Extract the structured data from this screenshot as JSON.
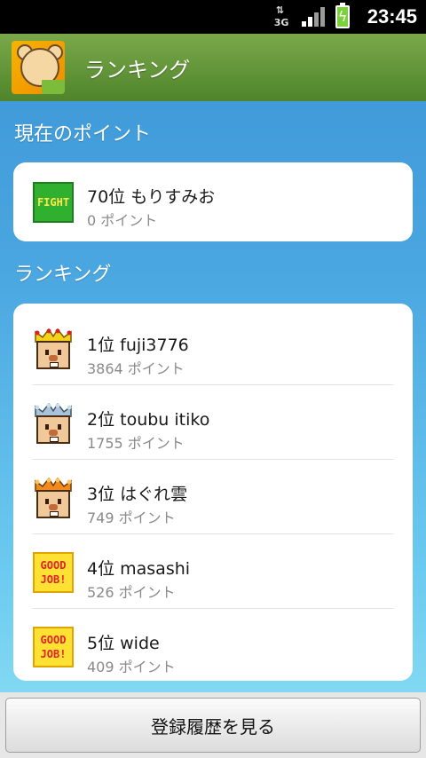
{
  "status_bar": {
    "network": "3G",
    "time": "23:45"
  },
  "header": {
    "title": "ランキング"
  },
  "current_points": {
    "section_title": "現在のポイント",
    "entry": {
      "name": "70位 もりすみお",
      "points": "0 ポイント",
      "badge": "FIGHT"
    }
  },
  "ranking": {
    "section_title": "ランキング",
    "entries": [
      {
        "name": "1位 fuji3776",
        "points": "3864 ポイント",
        "badge": "gold-crown-icon"
      },
      {
        "name": "2位 toubu itiko",
        "points": "1755 ポイント",
        "badge": "silver-crown-icon"
      },
      {
        "name": "3位 はぐれ雲",
        "points": "749 ポイント",
        "badge": "bronze-crown-icon"
      },
      {
        "name": "4位 masashi",
        "points": "526 ポイント",
        "badge_line1": "GOOD",
        "badge_line2": "JOB!"
      },
      {
        "name": "5位 wide",
        "points": "409 ポイント",
        "badge_line1": "GOOD",
        "badge_line2": "JOB!"
      }
    ]
  },
  "bottom_button": {
    "label": "登録履歴を見る"
  },
  "colors": {
    "gold": "#f4d21a",
    "silver": "#a9c3d8",
    "bronze": "#f08a1e"
  }
}
